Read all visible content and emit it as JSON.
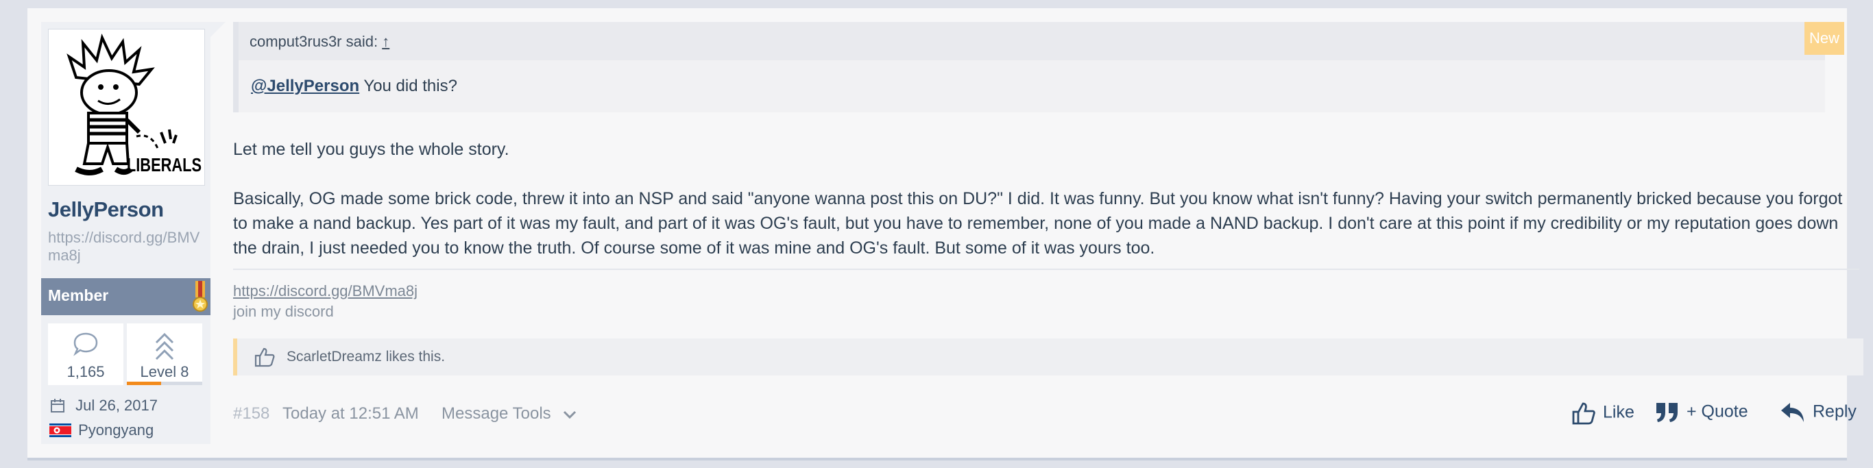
{
  "user": {
    "avatar_caption": "LIBERALS",
    "name": "JellyPerson",
    "link": "https://discord.gg/BMVma8j",
    "rank": "Member",
    "messages": "1,165",
    "level": "Level 8",
    "level_progress": 0.45,
    "joined": "Jul 26, 2017",
    "location": "Pyongyang"
  },
  "quote": {
    "author_line": "comput3rus3r said:",
    "arrow": "↑",
    "mention": "@JellyPerson",
    "text": " You did this?"
  },
  "badge": {
    "new": "New"
  },
  "message": {
    "p1": "Let me tell you guys the whole story.",
    "p2": "Basically, OG made some brick code, threw it into an NSP and said \"anyone wanna post this on DU?\" I did. It was funny. But you know what isn't funny? Having your switch permanently bricked because you forgot to make a nand backup. Yes part of it was my fault, and part of it was OG's fault, but you have to remember, none of you made a NAND backup. I don't care at this point if my credibility or my reputation goes down the drain, I just needed you to know the truth. Of course some of it was mine and OG's fault. But some of it was yours too."
  },
  "signature": {
    "link": "https://discord.gg/BMVma8j",
    "text": "join my discord"
  },
  "likes": {
    "text": "ScarletDreamz likes this."
  },
  "footer": {
    "post_number": "#158",
    "time": "Today at 12:51 AM",
    "tools": "Message Tools",
    "like": "Like",
    "quote": "+ Quote",
    "reply": "Reply"
  },
  "colors": {
    "accent": "#2c4a6d",
    "rank_bar": "#7889a3",
    "level_fill": "#f28a1b",
    "new_badge": "#fcd58c"
  }
}
